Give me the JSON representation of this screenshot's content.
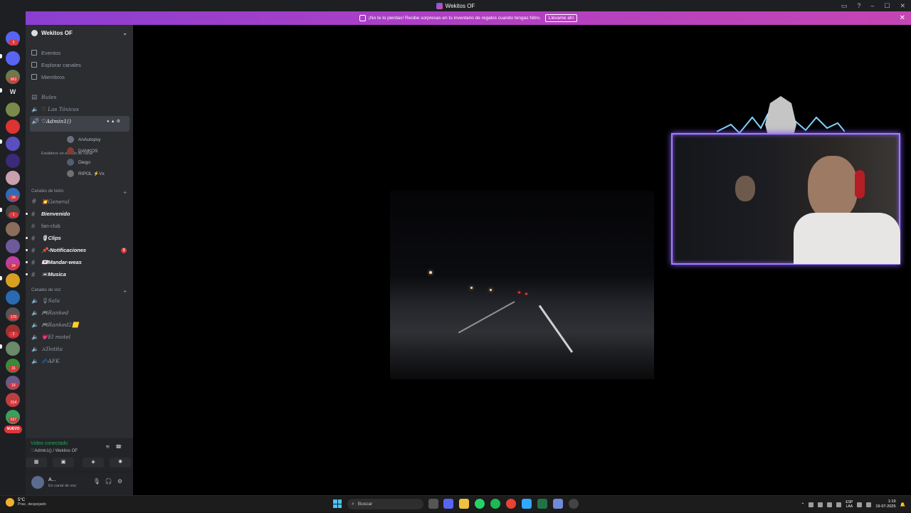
{
  "window": {
    "title": "Wekitos OF",
    "controls": [
      "inbox-icon",
      "help-icon",
      "minimize-icon",
      "maximize-icon",
      "close-icon"
    ]
  },
  "nitro_banner": {
    "text": "¡No te lo pierdas! Recibe sorpresas en tu inventario de regalos cuando tengas Nitro.",
    "cta": "Llévame ahí"
  },
  "server_rail": {
    "badges": [
      "3",
      "863",
      "34",
      "1",
      "34",
      "170",
      "2",
      "31",
      "16",
      "314",
      "627"
    ],
    "letter": "W",
    "new_label": "NUEVO"
  },
  "guild": {
    "name": "Wekitos OF"
  },
  "nav": {
    "events": "Eventos",
    "browse": "Explorar canales",
    "members": "Miembros"
  },
  "channels_top": [
    {
      "name": "Rules"
    },
    {
      "name": "♡ Las Tóxicas"
    },
    {
      "name": "♡Admin1()",
      "status": "Establece un estado de canal"
    }
  ],
  "voice_members": [
    {
      "name": "AnAutopsy"
    },
    {
      "name": "DANKOS"
    },
    {
      "name": "Diego"
    },
    {
      "name": "RIPOL ⚡Vx"
    }
  ],
  "text_category": "Canales de texto",
  "text_channels": [
    {
      "name": "💥General"
    },
    {
      "name": "Bienvenido"
    },
    {
      "name": "fan-club"
    },
    {
      "name": "🎙Clips"
    },
    {
      "name": "📌-Notificaciones",
      "badge": "3"
    },
    {
      "name": "💌Mandar-weas"
    },
    {
      "name": "📼Musica"
    }
  ],
  "voice_category": "Canales de voz",
  "voice_channels": [
    {
      "name": "🎙Sala"
    },
    {
      "name": "🎮Ranked"
    },
    {
      "name": "🎮Ranked2🟨"
    },
    {
      "name": "💗El motel"
    },
    {
      "name": "⚔Dotita"
    },
    {
      "name": "💤AFK"
    }
  ],
  "voice_panel": {
    "title": "Video conectado",
    "sub": "♡Admin1() / Wekitos OF"
  },
  "user_panel": {
    "name": "A...",
    "status": "En canal de voz"
  },
  "taskbar": {
    "weather_temp": "5°C",
    "weather_cond": "Prac. despejado",
    "search_placeholder": "Buscar",
    "lang_top": "ESP",
    "lang_bottom": "LAA",
    "time": "1:19",
    "date": "19-07-2025"
  },
  "colors": {
    "accent": "#5865f2",
    "online": "#23a55a",
    "danger": "#da373c",
    "facecam_border": "#a77bff"
  }
}
